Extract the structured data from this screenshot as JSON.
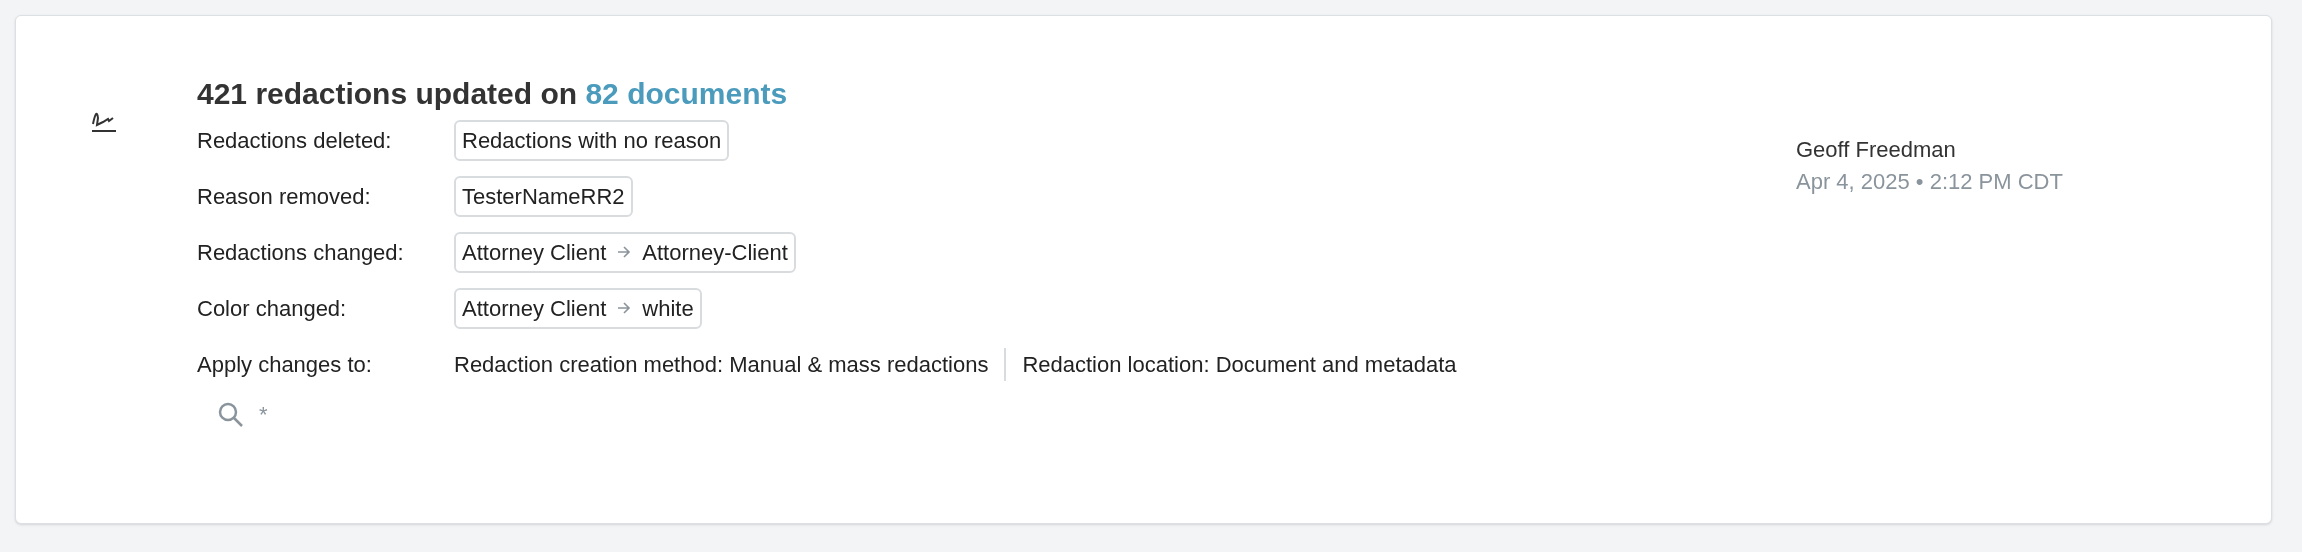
{
  "title": {
    "text": "421 redactions updated on",
    "link": "82 documents"
  },
  "rows": [
    {
      "label": "Redactions deleted:",
      "kind": "tag",
      "values": [
        "Redactions with no reason"
      ]
    },
    {
      "label": "Reason removed:",
      "kind": "tag",
      "values": [
        "TesterNameRR2"
      ]
    },
    {
      "label": "Redactions changed:",
      "kind": "change",
      "from": "Attorney Client",
      "to": "Attorney-Client"
    },
    {
      "label": "Color changed:",
      "kind": "change",
      "from": "Attorney Client",
      "to": "white"
    },
    {
      "label": "Apply changes to:",
      "kind": "plain",
      "values": [
        "Redaction creation method: Manual & mass redactions",
        "Redaction location: Document and metadata"
      ]
    }
  ],
  "search_query": "*",
  "author": "Geoff Freedman",
  "timestamp": "Apr 4, 2025 • 2:12 PM CDT"
}
